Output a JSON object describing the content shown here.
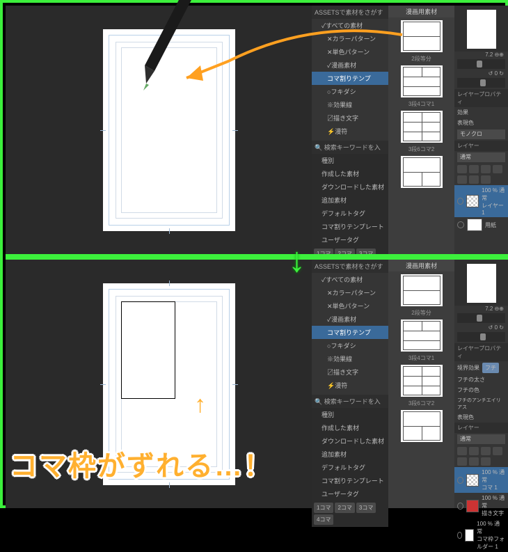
{
  "assets_header": "ASSETSで素材をさがす",
  "tree": {
    "all": "すべての素材",
    "color": "カラーパターン",
    "mono": "単色パターン",
    "manga": "漫画素材",
    "koma": "コマ割りテンプ",
    "fuki": "フキダシ",
    "kouka": "効果線",
    "moji": "描き文字",
    "manpu": "漫符"
  },
  "search_placeholder": "検索キーワードを入",
  "filters": {
    "shubetsu": "種別",
    "sakusei": "作成した素材",
    "download": "ダウンロードした素材",
    "tsuika": "追加素材",
    "deftag": "デフォルトタグ",
    "komawari": "コマ割りテンプレート",
    "usertag": "ユーザータグ"
  },
  "tags": [
    "1コマ",
    "2コマ",
    "3コマ",
    "4コマ"
  ],
  "thumbs_header": "漫画用素材",
  "thumb_caps": [
    "2段等分",
    "3段4コマ1",
    "3段6コマ2"
  ],
  "nav": {
    "zoom": "7.2",
    "deg": "0"
  },
  "layerprop_hdr": "レイヤープロパティ",
  "kouka_lbl": "効果",
  "hyogen_lbl": "表現色",
  "hyogen_val": "モノクロ",
  "kyokai_lbl": "境界効果",
  "kyokai_val": "フチ",
  "futi_haba": "フチの太さ",
  "futi_iro": "フチの色",
  "futi_aa": "フチのアンチエイリアス",
  "layerpanel_hdr": "レイヤー",
  "blend": "通常",
  "opacity": "100",
  "layer1": {
    "name": "100 % 通常",
    "sub": "レイヤー 1"
  },
  "layer_paper": "用紙",
  "layer_koma": {
    "name": "100 % 通常",
    "sub": "コマ 1"
  },
  "layer_folder": {
    "name": "100 % 通常",
    "sub": "コマ枠フォルダー 1"
  },
  "layer_moji": {
    "name": "100 % 通常",
    "sub": "描き文字"
  },
  "annotation": "コマ枠がずれる…！",
  "up_arrow": "↑",
  "down_arrow": "↓"
}
